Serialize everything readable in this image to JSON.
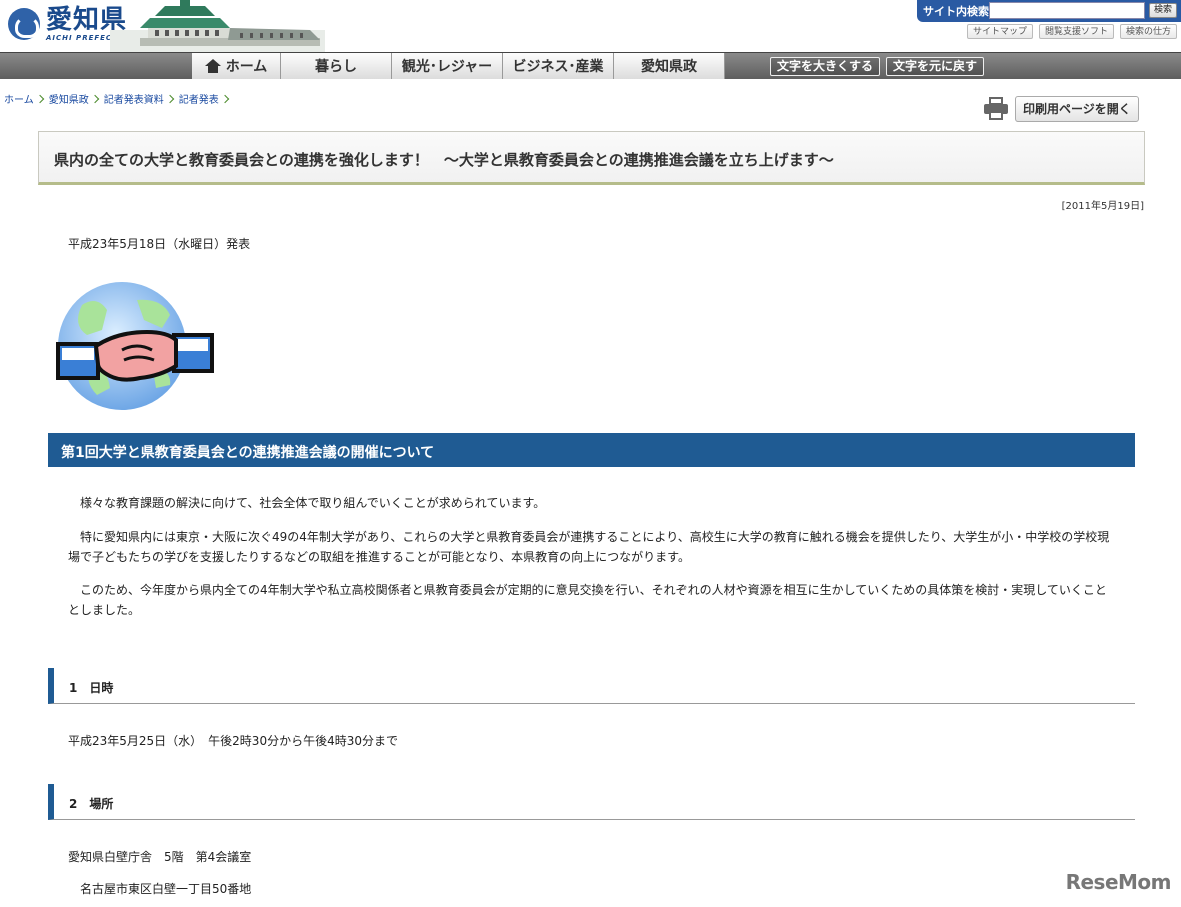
{
  "header": {
    "logo_jp": "愛知県",
    "logo_en": "AICHI PREFECTURE",
    "search_label": "サイト内検索",
    "search_value": "",
    "search_button": "検索",
    "util_links": [
      "サイトマップ",
      "閲覧支援ソフト",
      "検索の仕方"
    ]
  },
  "nav": {
    "items": [
      "ホーム",
      "暮らし",
      "観光･レジャー",
      "ビジネス･産業",
      "愛知県政"
    ],
    "font_larger": "文字を大きくする",
    "font_reset": "文字を元に戻す"
  },
  "breadcrumb": [
    "ホーム",
    "愛知県政",
    "記者発表資料",
    "記者発表"
  ],
  "print_button": "印刷用ページを開く",
  "article": {
    "title": "県内の全ての大学と教育委員会との連携を強化します！　～大学と県教育委員会との連携推進会議を立ち上げます～",
    "date_stamp": "[2011年5月19日]",
    "announce": "平成23年5月18日（水曜日）発表",
    "section_title": "第1回大学と県教育委員会との連携推進会議の開催について",
    "paragraphs": [
      "　様々な教育課題の解決に向けて、社会全体で取り組んでいくことが求められています。",
      "　特に愛知県内には東京・大阪に次ぐ49の4年制大学があり、これらの大学と県教育委員会が連携することにより、高校生に大学の教育に触れる機会を提供したり、大学生が小・中学校の学校現場で子どもたちの学びを支援したりするなどの取組を推進することが可能となり、本県教育の向上につながります。",
      "　このため、今年度から県内全ての4年制大学や私立高校関係者と県教育委員会が定期的に意見交換を行い、それぞれの人材や資源を相互に生かしていくための具体策を検討・実現していくこととしました。"
    ],
    "sub1_title": "1　日時",
    "sub1_body": "平成23年5月25日（水）　午後2時30分から午後4時30分まで",
    "sub2_title": "2　場所",
    "sub2_body": "愛知県白壁庁舎　5階　第4会議室",
    "sub2_address": "名古屋市東区白壁一丁目50番地"
  },
  "watermark": "ReseMom"
}
